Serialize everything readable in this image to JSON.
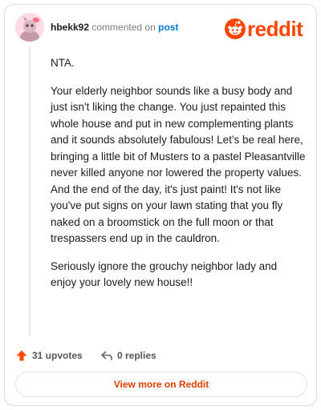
{
  "header": {
    "username": "hbekk92",
    "action_text": "commented on",
    "post_link": "post",
    "logo_text": "reddit"
  },
  "comment": {
    "paragraphs": [
      "NTA.",
      "Your elderly neighbor sounds like a busy body and just isn't liking the change. You just repainted this whole house and put in new complementing plants and it sounds absolutely fabulous! Let's be real here, bringing a little bit of Musters to a pastel Pleasantville never killed anyone nor lowered the property values. And the end of the day, it's just paint! It's not like you've put signs on your lawn stating that you fly naked on a broomstick on the full moon or that trespassers end up in the cauldron.",
      "Seriously ignore the grouchy neighbor lady and enjoy your lovely new house!!"
    ]
  },
  "actions": {
    "upvotes": "31 upvotes",
    "replies": "0 replies"
  },
  "footer": {
    "view_more": "View more on Reddit"
  },
  "colors": {
    "brand": "#ff4500",
    "link": "#0079d3",
    "avatar_bg": "#ffe4ec"
  },
  "icons": [
    "avatar",
    "reddit-snoo-icon",
    "upvote-arrow-icon",
    "reply-arrow-icon"
  ]
}
